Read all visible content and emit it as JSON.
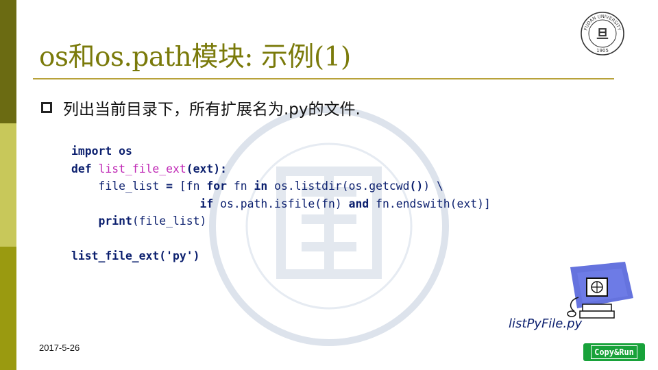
{
  "slide": {
    "title": "os和os.path模块: 示例(1)",
    "bullet": "列出当前目录下，所有扩展名为.py的文件.",
    "date": "2017-5-26"
  },
  "code": {
    "import_kw": "import",
    "import_mod": " os",
    "def_kw": "def",
    "def_name": "list_file_ext",
    "def_params": "(ext):",
    "l3_a": "    file_list ",
    "l3_eq": "=",
    "l3_b": " [fn ",
    "l3_for": "for",
    "l3_c": " fn ",
    "l3_in": "in",
    "l3_d": " os.listdir(os.getcwd",
    "l3_parens": "()",
    "l3_e": ") \\",
    "l4_indent": "                   ",
    "l4_if": "if",
    "l4_a": " os.path.isfile(fn) ",
    "l4_and": "and",
    "l4_b": " fn.endswith(ext)]",
    "print_kw": "    print",
    "print_args": "(file_list)",
    "call": "list_file_ext('py')"
  },
  "attachment": {
    "filename": "listPyFile.py",
    "button_label": "Copy&Run"
  },
  "logo": {
    "arc_text": "FUDAN UNIVERSITY",
    "year": "1905",
    "glyph": "旦"
  },
  "colors": {
    "title": "#7a7a0a",
    "code": "#0b1f6e",
    "function_name": "#c02ab6",
    "sidebar_top": "#6b6b12",
    "sidebar_mid": "#c8c85a",
    "sidebar_bottom": "#9a9a10",
    "button": "#18a23a"
  },
  "icons": {
    "bullet": "hollow-square-bullet-icon",
    "computer": "computer-icon",
    "logo": "fudan-university-seal-icon"
  }
}
